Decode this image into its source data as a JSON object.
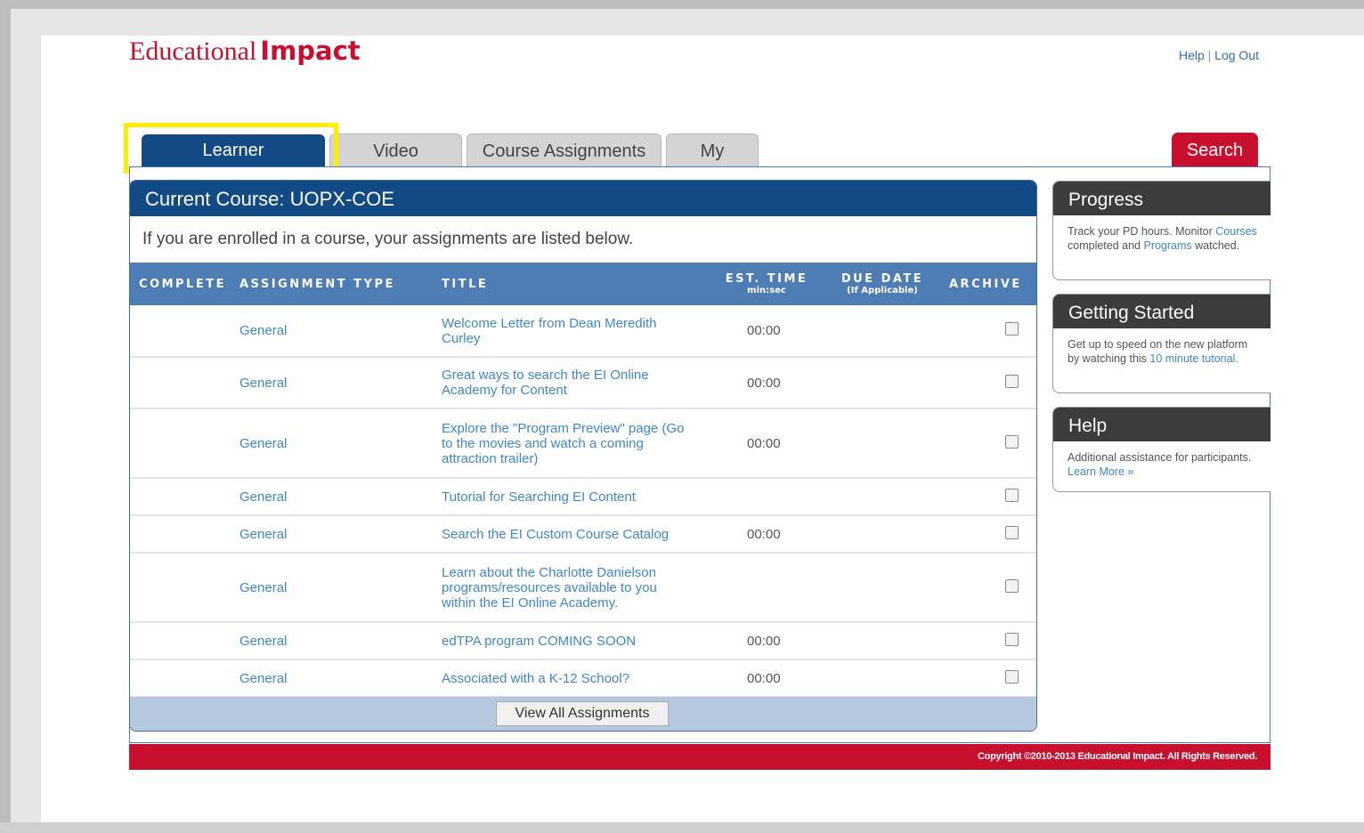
{
  "brand": {
    "word1": "Educational",
    "word2": "Impact"
  },
  "toplinks": {
    "help": "Help",
    "sep": " | ",
    "logout": "Log Out"
  },
  "tabs": [
    {
      "label": "Learner Dashboard",
      "active": true
    },
    {
      "label": "Video Library"
    },
    {
      "label": "Course Assignments"
    },
    {
      "label": "My Plan"
    }
  ],
  "search_tab": "Search",
  "course": {
    "heading": "Current Course: UOPX-COE",
    "intro": "If you are enrolled in a course, your assignments are listed below."
  },
  "table": {
    "headers": {
      "complete": "COMPLETE",
      "type": "ASSIGNMENT TYPE",
      "title": "TITLE",
      "time": "EST. TIME",
      "time_sub": "min:sec",
      "due": "DUE DATE",
      "due_sub": "(If Applicable)",
      "archive": "ARCHIVE"
    },
    "rows": [
      {
        "type": "General",
        "title": "Welcome Letter from Dean Meredith Curley",
        "time": "00:00"
      },
      {
        "type": "General",
        "title": "Great ways to search the EI Online Academy for Content",
        "time": "00:00"
      },
      {
        "type": "General",
        "title": "Explore the \"Program Preview\" page (Go to the movies and watch a coming attraction trailer)",
        "time": "00:00"
      },
      {
        "type": "General",
        "title": "Tutorial for Searching EI Content",
        "time": ""
      },
      {
        "type": "General",
        "title": "Search the EI Custom Course Catalog",
        "time": "00:00"
      },
      {
        "type": "General",
        "title": "Learn about the Charlotte Danielson programs/resources available to you within the EI Online Academy.",
        "time": ""
      },
      {
        "type": "General",
        "title": "edTPA program COMING SOON",
        "time": "00:00"
      },
      {
        "type": "General",
        "title": "Associated with a K-12 School?",
        "time": "00:00"
      }
    ],
    "view_all": "View All Assignments"
  },
  "sidebar": {
    "progress": {
      "title": "Progress",
      "text1": "Track your PD hours. Monitor ",
      "link1": "Courses",
      "text2": " completed and ",
      "link2": "Programs",
      "text3": " watched."
    },
    "getting_started": {
      "title": "Getting Started",
      "text1": "Get up to speed on the new platform by watching this ",
      "link1": "10 minute tutorial."
    },
    "help": {
      "title": "Help",
      "text1": "Additional assistance for participants. ",
      "link1": "Learn More »"
    }
  },
  "footer": "Copyright ©2010-2013 Educational Impact. All Rights Reserved.",
  "colors": {
    "brand_red": "#c8102e",
    "nav_blue": "#124a85",
    "header_blue": "#4e7cb4",
    "link_blue": "#3f86d0",
    "highlight_yellow": "#ffee00"
  }
}
